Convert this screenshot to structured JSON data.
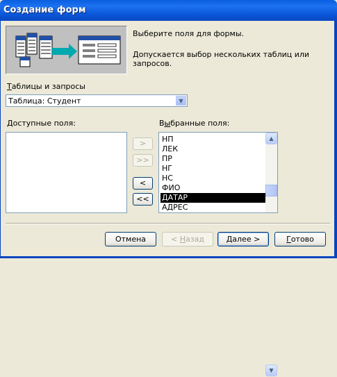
{
  "window": {
    "title": "Создание форм"
  },
  "intro": {
    "line1": "Выберите поля для формы.",
    "line2": "Допускается выбор нескольких таблиц или запросов."
  },
  "tables": {
    "label_u": "Т",
    "label_rest": "аблицы и запросы",
    "selected": "Таблица: Студент"
  },
  "available": {
    "label_u": "Д",
    "label_rest": "оступные поля:",
    "items": []
  },
  "chosen": {
    "label_pre": "В",
    "label_u": "ы",
    "label_rest": "бранные поля:",
    "items": [
      "НП",
      "ЛЕК",
      "ПР",
      "НГ",
      "НС",
      "ФИО",
      "ДАТАР",
      "АДРЕС"
    ],
    "selected": "ДАТАР"
  },
  "move_buttons": {
    "add": ">",
    "add_all": ">>",
    "remove": "<",
    "remove_all": "<<"
  },
  "footer": {
    "cancel": "Отмена",
    "back_pre": "< ",
    "back_u": "Н",
    "back_rest": "азад",
    "next_u": "Д",
    "next_rest": "алее >",
    "finish_u": "Г",
    "finish_rest": "отово"
  },
  "colors": {
    "titlebar": "#0A5FE0",
    "dialog": "#ECE9D8",
    "selection": "#000000"
  }
}
